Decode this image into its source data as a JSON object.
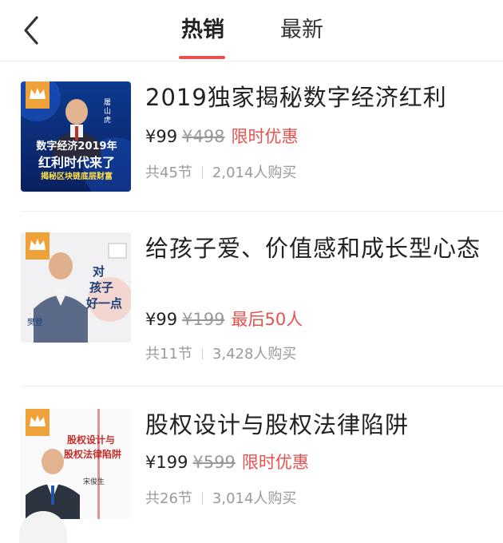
{
  "tabs": [
    {
      "label": "热销",
      "active": true
    },
    {
      "label": "最新",
      "active": false
    }
  ],
  "colors": {
    "accent": "#e9504e",
    "muted": "#999999"
  },
  "courses": [
    {
      "title": "2019独家揭秘数字经济红利",
      "price": "¥99",
      "original_price": "¥498",
      "promo": "限时优惠",
      "lessons": "共45节",
      "buyers": "2,014人购买",
      "thumb": {
        "line1": "数字经济2019年",
        "line2": "红利时代来了",
        "line3": "揭秘区块链底层财富",
        "name": "屠山虎"
      }
    },
    {
      "title": "给孩子爱、价值感和成长型心态",
      "price": "¥99",
      "original_price": "¥199",
      "promo": "最后50人",
      "lessons": "共11节",
      "buyers": "3,428人购买",
      "thumb": {
        "line1": "对",
        "line2": "孩子",
        "line3": "好一点",
        "name": "樊登"
      }
    },
    {
      "title": "股权设计与股权法律陷阱",
      "price": "¥199",
      "original_price": "¥599",
      "promo": "限时优惠",
      "lessons": "共26节",
      "buyers": "3,014人购买",
      "thumb": {
        "line1": "股权设计与",
        "line2": "股权法律陷阱",
        "line3": "",
        "name": "宋俊生"
      }
    }
  ]
}
